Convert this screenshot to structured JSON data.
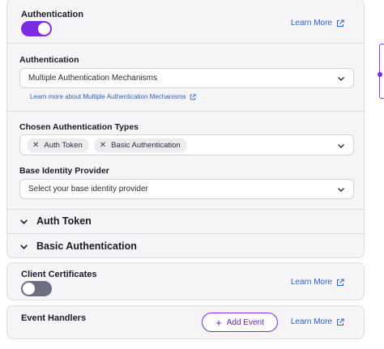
{
  "auth_panel": {
    "title": "Authentication",
    "toggle_on": true,
    "learn_more": "Learn More",
    "mechanism": {
      "label": "Authentication",
      "value": "Multiple Authentication Mechanisms",
      "help_link": "Learn more about Multiple Authentication Mechanisms"
    },
    "types": {
      "label": "Chosen Authentication Types",
      "chips": [
        "Auth Token",
        "Basic Authentication"
      ]
    },
    "identity": {
      "label": "Base Identity Provider",
      "placeholder": "Select your base identity provider"
    },
    "sections": [
      "Auth Token",
      "Basic Authentication"
    ]
  },
  "client_certificates": {
    "title": "Client Certificates",
    "toggle_on": false,
    "learn_more": "Learn More"
  },
  "event_handlers": {
    "title": "Event Handlers",
    "add_label": "Add Event",
    "learn_more": "Learn More"
  },
  "colors": {
    "accent": "#7b2be0",
    "link": "#2f62c8",
    "toggle_off": "#6e6e82"
  },
  "icons": {
    "external": "external-link-icon",
    "chevron": "chevron-down-icon",
    "remove": "close-icon",
    "add": "plus-icon"
  }
}
